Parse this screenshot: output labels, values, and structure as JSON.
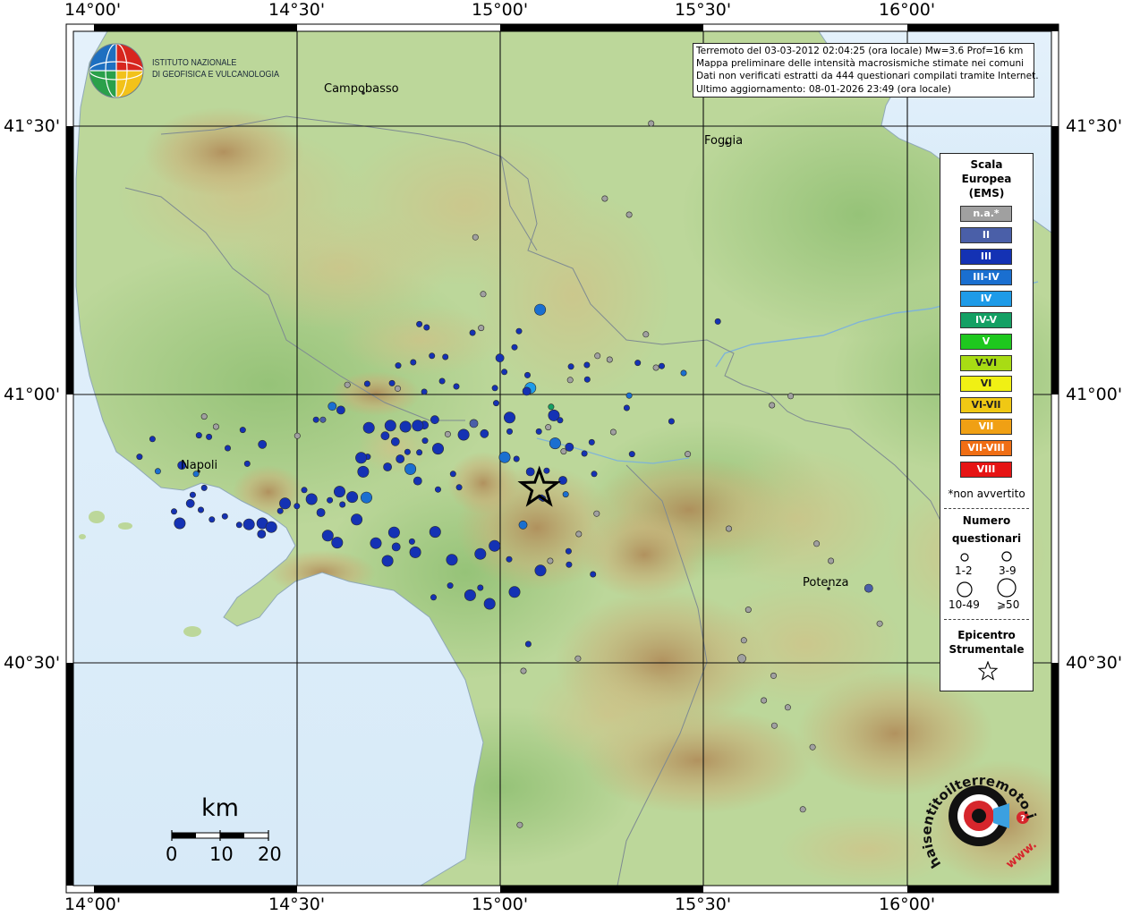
{
  "map": {
    "ticks_longitude": [
      "14°00'",
      "14°30'",
      "15°00'",
      "15°30'",
      "16°00'"
    ],
    "ticks_latitude": [
      "41°30'",
      "41°00'",
      "40°30'"
    ],
    "cities": [
      {
        "name": "Campobasso"
      },
      {
        "name": "Foggia"
      },
      {
        "name": "Napoli"
      },
      {
        "name": "Potenza"
      }
    ]
  },
  "info_box": {
    "line1": "Terremoto del 03-03-2012 02:04:25 (ora locale) Mw=3.6 Prof=16 km",
    "line2": "Mappa preliminare delle intensità macrosismiche stimate nei comuni",
    "line3": "Dati non verificati estratti da 444 questionari compilati tramite Internet.",
    "line4": "Ultimo aggiornamento: 08-01-2026 23:49 (ora locale)"
  },
  "ingv": {
    "line1": "ISTITUTO NAZIONALE",
    "line2": "DI GEOFISICA E VULCANOLOGIA"
  },
  "legend": {
    "title_line1": "Scala",
    "title_line2": "Europea",
    "title_line3": "(EMS)",
    "classes": [
      {
        "label": "n.a.*",
        "color": "#a0a0a0"
      },
      {
        "label": "II",
        "color": "#4a5fa8"
      },
      {
        "label": "III",
        "color": "#1432b4"
      },
      {
        "label": "III-IV",
        "color": "#1a6fd0"
      },
      {
        "label": "IV",
        "color": "#1e9be8"
      },
      {
        "label": "IV-V",
        "color": "#14a064"
      },
      {
        "label": "V",
        "color": "#1ec81e"
      },
      {
        "label": "V-VI",
        "color": "#a8dc14"
      },
      {
        "label": "VI",
        "color": "#f0f014"
      },
      {
        "label": "VI-VII",
        "color": "#f0c814"
      },
      {
        "label": "VII",
        "color": "#f0a014"
      },
      {
        "label": "VII-VIII",
        "color": "#f06e14"
      },
      {
        "label": "VIII",
        "color": "#e61414"
      }
    ],
    "note": "*non avvertito",
    "count_title_line1": "Numero",
    "count_title_line2": "questionari",
    "count_classes": [
      "1-2",
      "3-9",
      "10-49",
      "⩾50"
    ],
    "epicenter_line1": "Epicentro",
    "epicenter_line2": "Strumentale"
  },
  "scalebar": {
    "title": "km",
    "labels": [
      "0",
      "10",
      "20"
    ]
  },
  "hsit_logo": {
    "text": "haisentitoilterremoto.it",
    "www": "www."
  },
  "observations": [
    {
      "lon": 15.097,
      "lat": 41.158,
      "ems": "III-IV",
      "n": "10-49"
    },
    {
      "lon": 15.073,
      "lat": 41.012,
      "ems": "IV",
      "n": "10-49"
    },
    {
      "lon": 15.064,
      "lat": 41.006,
      "ems": "III",
      "n": "3-9"
    },
    {
      "lon": 15.131,
      "lat": 40.961,
      "ems": "III",
      "n": "10-49"
    },
    {
      "lon": 15.124,
      "lat": 40.977,
      "ems": "IV-V",
      "n": "1-2"
    },
    {
      "lon": 15.146,
      "lat": 40.952,
      "ems": "III",
      "n": "1-2"
    },
    {
      "lon": 15.134,
      "lat": 40.909,
      "ems": "III-IV",
      "n": "10-49"
    },
    {
      "lon": 15.169,
      "lat": 40.902,
      "ems": "III",
      "n": "3-9"
    },
    {
      "lon": 15.153,
      "lat": 40.84,
      "ems": "III",
      "n": "3-9"
    },
    {
      "lon": 15.113,
      "lat": 40.858,
      "ems": "III",
      "n": "1-2"
    },
    {
      "lon": 15.073,
      "lat": 40.856,
      "ems": "III",
      "n": "3-9"
    },
    {
      "lon": 15.039,
      "lat": 40.88,
      "ems": "III",
      "n": "1-2"
    },
    {
      "lon": 15.01,
      "lat": 40.883,
      "ems": "III-IV",
      "n": "10-49"
    },
    {
      "lon": 15.022,
      "lat": 40.931,
      "ems": "III",
      "n": "1-2"
    },
    {
      "lon": 15.022,
      "lat": 40.957,
      "ems": "III",
      "n": "10-49"
    },
    {
      "lon": 14.989,
      "lat": 40.984,
      "ems": "III",
      "n": "1-2"
    },
    {
      "lon": 14.934,
      "lat": 40.946,
      "ems": "II",
      "n": "3-9"
    },
    {
      "lon": 14.96,
      "lat": 40.927,
      "ems": "III",
      "n": "3-9"
    },
    {
      "lon": 14.909,
      "lat": 40.925,
      "ems": "III",
      "n": "10-49"
    },
    {
      "lon": 14.838,
      "lat": 40.953,
      "ems": "III",
      "n": "3-9"
    },
    {
      "lon": 14.812,
      "lat": 40.943,
      "ems": "III",
      "n": "3-9"
    },
    {
      "lon": 14.766,
      "lat": 40.94,
      "ems": "III",
      "n": "10-49"
    },
    {
      "lon": 14.729,
      "lat": 40.942,
      "ems": "III",
      "n": "10-49"
    },
    {
      "lon": 14.796,
      "lat": 40.942,
      "ems": "III",
      "n": "10-49"
    },
    {
      "lon": 14.741,
      "lat": 40.912,
      "ems": "III",
      "n": "3-9"
    },
    {
      "lon": 14.716,
      "lat": 40.923,
      "ems": "III",
      "n": "3-9"
    },
    {
      "lon": 14.676,
      "lat": 40.938,
      "ems": "III",
      "n": "10-49"
    },
    {
      "lon": 14.607,
      "lat": 40.971,
      "ems": "III",
      "n": "3-9"
    },
    {
      "lon": 14.586,
      "lat": 40.978,
      "ems": "III-IV",
      "n": "3-9"
    },
    {
      "lon": 14.563,
      "lat": 40.953,
      "ems": "II",
      "n": "1-2"
    },
    {
      "lon": 14.546,
      "lat": 40.953,
      "ems": "III",
      "n": "1-2"
    },
    {
      "lon": 14.5,
      "lat": 40.923,
      "ems": "n.a.",
      "n": "1-2"
    },
    {
      "lon": 14.414,
      "lat": 40.907,
      "ems": "III",
      "n": "3-9"
    },
    {
      "lon": 14.377,
      "lat": 40.871,
      "ems": "III",
      "n": "1-2"
    },
    {
      "lon": 14.366,
      "lat": 40.934,
      "ems": "III",
      "n": "1-2"
    },
    {
      "lon": 14.329,
      "lat": 40.9,
      "ems": "III",
      "n": "1-2"
    },
    {
      "lon": 14.283,
      "lat": 40.921,
      "ems": "III",
      "n": "1-2"
    },
    {
      "lon": 14.3,
      "lat": 40.94,
      "ems": "n.a.",
      "n": "1-2"
    },
    {
      "lon": 14.271,
      "lat": 40.959,
      "ems": "n.a.",
      "n": "1-2"
    },
    {
      "lon": 14.258,
      "lat": 40.924,
      "ems": "III",
      "n": "1-2"
    },
    {
      "lon": 14.216,
      "lat": 40.868,
      "ems": "III",
      "n": "3-9"
    },
    {
      "lon": 14.251,
      "lat": 40.852,
      "ems": "III-IV",
      "n": "1-2"
    },
    {
      "lon": 14.271,
      "lat": 40.826,
      "ems": "III",
      "n": "1-2"
    },
    {
      "lon": 14.243,
      "lat": 40.813,
      "ems": "III",
      "n": "1-2"
    },
    {
      "lon": 14.157,
      "lat": 40.857,
      "ems": "III-IV",
      "n": "1-2"
    },
    {
      "lon": 14.144,
      "lat": 40.917,
      "ems": "III",
      "n": "1-2"
    },
    {
      "lon": 14.112,
      "lat": 40.884,
      "ems": "III",
      "n": "1-2"
    },
    {
      "lon": 14.197,
      "lat": 40.782,
      "ems": "III",
      "n": "1-2"
    },
    {
      "lon": 14.211,
      "lat": 40.76,
      "ems": "III",
      "n": "10-49"
    },
    {
      "lon": 14.237,
      "lat": 40.797,
      "ems": "III",
      "n": "3-9"
    },
    {
      "lon": 14.263,
      "lat": 40.785,
      "ems": "III",
      "n": "1-2"
    },
    {
      "lon": 14.29,
      "lat": 40.767,
      "ems": "III",
      "n": "1-2"
    },
    {
      "lon": 14.322,
      "lat": 40.773,
      "ems": "III",
      "n": "1-2"
    },
    {
      "lon": 14.357,
      "lat": 40.757,
      "ems": "III",
      "n": "1-2"
    },
    {
      "lon": 14.381,
      "lat": 40.758,
      "ems": "III",
      "n": "10-49"
    },
    {
      "lon": 14.414,
      "lat": 40.76,
      "ems": "III",
      "n": "10-49"
    },
    {
      "lon": 14.436,
      "lat": 40.753,
      "ems": "III",
      "n": "10-49"
    },
    {
      "lon": 14.412,
      "lat": 40.74,
      "ems": "III",
      "n": "3-9"
    },
    {
      "lon": 14.458,
      "lat": 40.783,
      "ems": "III",
      "n": "1-2"
    },
    {
      "lon": 14.47,
      "lat": 40.797,
      "ems": "III",
      "n": "10-49"
    },
    {
      "lon": 14.499,
      "lat": 40.792,
      "ems": "III",
      "n": "1-2"
    },
    {
      "lon": 14.517,
      "lat": 40.822,
      "ems": "III",
      "n": "1-2"
    },
    {
      "lon": 14.535,
      "lat": 40.805,
      "ems": "III",
      "n": "10-49"
    },
    {
      "lon": 14.558,
      "lat": 40.78,
      "ems": "III",
      "n": "3-9"
    },
    {
      "lon": 14.58,
      "lat": 40.803,
      "ems": "III",
      "n": "1-2"
    },
    {
      "lon": 14.604,
      "lat": 40.819,
      "ems": "III",
      "n": "10-49"
    },
    {
      "lon": 14.635,
      "lat": 40.809,
      "ems": "III",
      "n": "10-49"
    },
    {
      "lon": 14.67,
      "lat": 40.808,
      "ems": "III-IV",
      "n": "10-49"
    },
    {
      "lon": 14.646,
      "lat": 40.767,
      "ems": "III",
      "n": "10-49"
    },
    {
      "lon": 14.611,
      "lat": 40.795,
      "ems": "III",
      "n": "1-2"
    },
    {
      "lon": 14.575,
      "lat": 40.737,
      "ems": "III",
      "n": "10-49"
    },
    {
      "lon": 14.598,
      "lat": 40.724,
      "ems": "III",
      "n": "10-49"
    },
    {
      "lon": 14.673,
      "lat": 40.884,
      "ems": "III",
      "n": "1-2"
    },
    {
      "lon": 14.657,
      "lat": 40.882,
      "ems": "III",
      "n": "10-49"
    },
    {
      "lon": 14.662,
      "lat": 40.856,
      "ems": "III",
      "n": "10-49"
    },
    {
      "lon": 14.722,
      "lat": 40.865,
      "ems": "III",
      "n": "3-9"
    },
    {
      "lon": 14.753,
      "lat": 40.88,
      "ems": "III",
      "n": "3-9"
    },
    {
      "lon": 14.771,
      "lat": 40.893,
      "ems": "III",
      "n": "1-2"
    },
    {
      "lon": 14.8,
      "lat": 40.892,
      "ems": "III",
      "n": "1-2"
    },
    {
      "lon": 14.814,
      "lat": 40.914,
      "ems": "III",
      "n": "1-2"
    },
    {
      "lon": 14.846,
      "lat": 40.899,
      "ems": "III",
      "n": "10-49"
    },
    {
      "lon": 14.87,
      "lat": 40.926,
      "ems": "n.a.",
      "n": "1-2"
    },
    {
      "lon": 14.778,
      "lat": 40.861,
      "ems": "III-IV",
      "n": "10-49"
    },
    {
      "lon": 14.796,
      "lat": 40.839,
      "ems": "III",
      "n": "3-9"
    },
    {
      "lon": 14.846,
      "lat": 40.823,
      "ems": "III",
      "n": "1-2"
    },
    {
      "lon": 14.898,
      "lat": 40.827,
      "ems": "III",
      "n": "1-2"
    },
    {
      "lon": 14.883,
      "lat": 40.852,
      "ems": "III",
      "n": "1-2"
    },
    {
      "lon": 14.839,
      "lat": 40.744,
      "ems": "III",
      "n": "10-49"
    },
    {
      "lon": 14.738,
      "lat": 40.743,
      "ems": "III",
      "n": "10-49"
    },
    {
      "lon": 14.782,
      "lat": 40.726,
      "ems": "III",
      "n": "1-2"
    },
    {
      "lon": 14.743,
      "lat": 40.716,
      "ems": "III",
      "n": "3-9"
    },
    {
      "lon": 14.693,
      "lat": 40.723,
      "ems": "III",
      "n": "10-49"
    },
    {
      "lon": 14.722,
      "lat": 40.69,
      "ems": "III",
      "n": "10-49"
    },
    {
      "lon": 14.79,
      "lat": 40.706,
      "ems": "III",
      "n": "10-49"
    },
    {
      "lon": 14.88,
      "lat": 40.692,
      "ems": "III",
      "n": "10-49"
    },
    {
      "lon": 14.876,
      "lat": 40.644,
      "ems": "III",
      "n": "1-2"
    },
    {
      "lon": 14.95,
      "lat": 40.703,
      "ems": "III",
      "n": "10-49"
    },
    {
      "lon": 15.021,
      "lat": 40.693,
      "ems": "III",
      "n": "1-2"
    },
    {
      "lon": 15.055,
      "lat": 40.757,
      "ems": "III-IV",
      "n": "3-9"
    },
    {
      "lon": 15.098,
      "lat": 40.672,
      "ems": "III",
      "n": "10-49"
    },
    {
      "lon": 15.122,
      "lat": 40.69,
      "ems": "n.a.",
      "n": "1-2"
    },
    {
      "lon": 15.167,
      "lat": 40.708,
      "ems": "III",
      "n": "1-2"
    },
    {
      "lon": 15.227,
      "lat": 40.665,
      "ems": "III",
      "n": "1-2"
    },
    {
      "lon": 15.034,
      "lat": 40.632,
      "ems": "III",
      "n": "10-49"
    },
    {
      "lon": 14.973,
      "lat": 40.61,
      "ems": "III",
      "n": "10-49"
    },
    {
      "lon": 14.95,
      "lat": 40.64,
      "ems": "III",
      "n": "1-2"
    },
    {
      "lon": 14.985,
      "lat": 40.718,
      "ems": "III",
      "n": "10-49"
    },
    {
      "lon": 14.925,
      "lat": 40.626,
      "ems": "III",
      "n": "10-49"
    },
    {
      "lon": 14.835,
      "lat": 40.622,
      "ems": "III",
      "n": "1-2"
    },
    {
      "lon": 15.068,
      "lat": 40.535,
      "ems": "III",
      "n": "1-2"
    },
    {
      "lon": 15.117,
      "lat": 40.939,
      "ems": "n.a.",
      "n": "1-2"
    },
    {
      "lon": 15.094,
      "lat": 40.931,
      "ems": "III",
      "n": "1-2"
    },
    {
      "lon": 15.104,
      "lat": 40.806,
      "ems": "III",
      "n": "1-2"
    },
    {
      "lon": 15.192,
      "lat": 40.74,
      "ems": "n.a.",
      "n": "1-2"
    },
    {
      "lon": 15.236,
      "lat": 40.778,
      "ems": "n.a.",
      "n": "1-2"
    },
    {
      "lon": 15.16,
      "lat": 40.814,
      "ems": "III-IV",
      "n": "1-2"
    },
    {
      "lon": 15.155,
      "lat": 40.894,
      "ems": "n.a.",
      "n": "1-2"
    },
    {
      "lon": 15.206,
      "lat": 40.89,
      "ems": "III",
      "n": "1-2"
    },
    {
      "lon": 15.23,
      "lat": 40.852,
      "ems": "III",
      "n": "1-2"
    },
    {
      "lon": 15.277,
      "lat": 40.93,
      "ems": "n.a.",
      "n": "1-2"
    },
    {
      "lon": 15.224,
      "lat": 40.911,
      "ems": "III",
      "n": "1-2"
    },
    {
      "lon": 15.316,
      "lat": 40.998,
      "ems": "III-IV",
      "n": "1-2"
    },
    {
      "lon": 15.323,
      "lat": 40.889,
      "ems": "III",
      "n": "1-2"
    },
    {
      "lon": 15.213,
      "lat": 41.028,
      "ems": "III",
      "n": "1-2"
    },
    {
      "lon": 15.171,
      "lat": 41.027,
      "ems": "n.a.",
      "n": "1-2"
    },
    {
      "lon": 15.173,
      "lat": 41.052,
      "ems": "III",
      "n": "1-2"
    },
    {
      "lon": 15.212,
      "lat": 41.055,
      "ems": "III",
      "n": "1-2"
    },
    {
      "lon": 15.238,
      "lat": 41.072,
      "ems": "n.a.",
      "n": "1-2"
    },
    {
      "lon": 15.337,
      "lat": 41.059,
      "ems": "III",
      "n": "1-2"
    },
    {
      "lon": 15.045,
      "lat": 41.118,
      "ems": "III",
      "n": "1-2"
    },
    {
      "lon": 15.034,
      "lat": 41.088,
      "ems": "III",
      "n": "1-2"
    },
    {
      "lon": 15.066,
      "lat": 41.036,
      "ems": "III",
      "n": "1-2"
    },
    {
      "lon": 14.998,
      "lat": 41.068,
      "ems": "III",
      "n": "3-9"
    },
    {
      "lon": 14.986,
      "lat": 41.012,
      "ems": "III",
      "n": "1-2"
    },
    {
      "lon": 15.009,
      "lat": 41.042,
      "ems": "III",
      "n": "1-2"
    },
    {
      "lon": 14.952,
      "lat": 41.124,
      "ems": "n.a.",
      "n": "1-2"
    },
    {
      "lon": 14.931,
      "lat": 41.115,
      "ems": "III",
      "n": "1-2"
    },
    {
      "lon": 14.818,
      "lat": 41.125,
      "ems": "III",
      "n": "1-2"
    },
    {
      "lon": 14.831,
      "lat": 41.072,
      "ems": "III",
      "n": "1-2"
    },
    {
      "lon": 14.864,
      "lat": 41.07,
      "ems": "III",
      "n": "1-2"
    },
    {
      "lon": 14.812,
      "lat": 41.005,
      "ems": "III",
      "n": "1-2"
    },
    {
      "lon": 14.747,
      "lat": 41.011,
      "ems": "n.a.",
      "n": "1-2"
    },
    {
      "lon": 14.891,
      "lat": 41.015,
      "ems": "III",
      "n": "1-2"
    },
    {
      "lon": 14.957,
      "lat": 41.187,
      "ems": "n.a.",
      "n": "1-2"
    },
    {
      "lon": 15.1,
      "lat": 40.808,
      "ems": "III",
      "n": "1-2"
    },
    {
      "lon": 15.168,
      "lat": 40.683,
      "ems": "III",
      "n": "1-2"
    },
    {
      "lon": 15.31,
      "lat": 40.975,
      "ems": "III",
      "n": "1-2"
    },
    {
      "lon": 15.357,
      "lat": 41.112,
      "ems": "n.a.",
      "n": "1-2"
    },
    {
      "lon": 15.396,
      "lat": 41.053,
      "ems": "III",
      "n": "1-2"
    },
    {
      "lon": 15.268,
      "lat": 41.065,
      "ems": "n.a.",
      "n": "1-2"
    },
    {
      "lon": 15.382,
      "lat": 41.05,
      "ems": "n.a.",
      "n": "1-2"
    },
    {
      "lon": 15.316,
      "lat": 41.335,
      "ems": "n.a.",
      "n": "1-2"
    },
    {
      "lon": 15.256,
      "lat": 41.365,
      "ems": "n.a.",
      "n": "1-2"
    },
    {
      "lon": 15.37,
      "lat": 41.505,
      "ems": "n.a.",
      "n": "1-2"
    },
    {
      "lon": 15.534,
      "lat": 41.136,
      "ems": "III",
      "n": "1-2"
    },
    {
      "lon": 14.938,
      "lat": 41.293,
      "ems": "n.a.",
      "n": "1-2"
    },
    {
      "lon": 14.8,
      "lat": 41.131,
      "ems": "III",
      "n": "1-2"
    },
    {
      "lon": 14.623,
      "lat": 41.018,
      "ems": "n.a.",
      "n": "1-2"
    },
    {
      "lon": 14.672,
      "lat": 41.02,
      "ems": "III",
      "n": "1-2"
    },
    {
      "lon": 14.733,
      "lat": 41.021,
      "ems": "III",
      "n": "1-2"
    },
    {
      "lon": 14.748,
      "lat": 41.054,
      "ems": "III",
      "n": "1-2"
    },
    {
      "lon": 14.785,
      "lat": 41.06,
      "ems": "III",
      "n": "1-2"
    },
    {
      "lon": 14.856,
      "lat": 41.025,
      "ems": "III",
      "n": "1-2"
    },
    {
      "lon": 15.45,
      "lat": 41.04,
      "ems": "III-IV",
      "n": "1-2"
    },
    {
      "lon": 15.42,
      "lat": 40.95,
      "ems": "III",
      "n": "1-2"
    },
    {
      "lon": 15.46,
      "lat": 40.889,
      "ems": "n.a.",
      "n": "1-2"
    },
    {
      "lon": 15.713,
      "lat": 40.997,
      "ems": "n.a.",
      "n": "1-2"
    },
    {
      "lon": 15.667,
      "lat": 40.98,
      "ems": "n.a.",
      "n": "1-2"
    },
    {
      "lon": 15.812,
      "lat": 40.69,
      "ems": "n.a.",
      "n": "1-2"
    },
    {
      "lon": 15.777,
      "lat": 40.722,
      "ems": "n.a.",
      "n": "1-2"
    },
    {
      "lon": 15.905,
      "lat": 40.639,
      "ems": "II",
      "n": "3-9"
    },
    {
      "lon": 15.561,
      "lat": 40.75,
      "ems": "n.a.",
      "n": "1-2"
    },
    {
      "lon": 15.609,
      "lat": 40.599,
      "ems": "n.a.",
      "n": "1-2"
    },
    {
      "lon": 15.593,
      "lat": 40.508,
      "ems": "n.a.",
      "n": "3-9"
    },
    {
      "lon": 15.598,
      "lat": 40.542,
      "ems": "n.a.",
      "n": "1-2"
    },
    {
      "lon": 15.671,
      "lat": 40.476,
      "ems": "n.a.",
      "n": "1-2"
    },
    {
      "lon": 15.647,
      "lat": 40.43,
      "ems": "n.a.",
      "n": "1-2"
    },
    {
      "lon": 15.673,
      "lat": 40.383,
      "ems": "n.a.",
      "n": "1-2"
    },
    {
      "lon": 15.706,
      "lat": 40.417,
      "ems": "n.a.",
      "n": "1-2"
    },
    {
      "lon": 15.767,
      "lat": 40.343,
      "ems": "n.a.",
      "n": "1-2"
    },
    {
      "lon": 15.743,
      "lat": 40.227,
      "ems": "n.a.",
      "n": "1-2"
    },
    {
      "lon": 15.932,
      "lat": 40.573,
      "ems": "n.a.",
      "n": "1-2"
    },
    {
      "lon": 15.056,
      "lat": 40.485,
      "ems": "n.a.",
      "n": "1-2"
    },
    {
      "lon": 15.047,
      "lat": 40.198,
      "ems": "n.a.",
      "n": "1-2"
    },
    {
      "lon": 15.19,
      "lat": 40.508,
      "ems": "n.a.",
      "n": "1-2"
    }
  ],
  "epicenter": {
    "lon": 15.095,
    "lat": 40.825
  }
}
